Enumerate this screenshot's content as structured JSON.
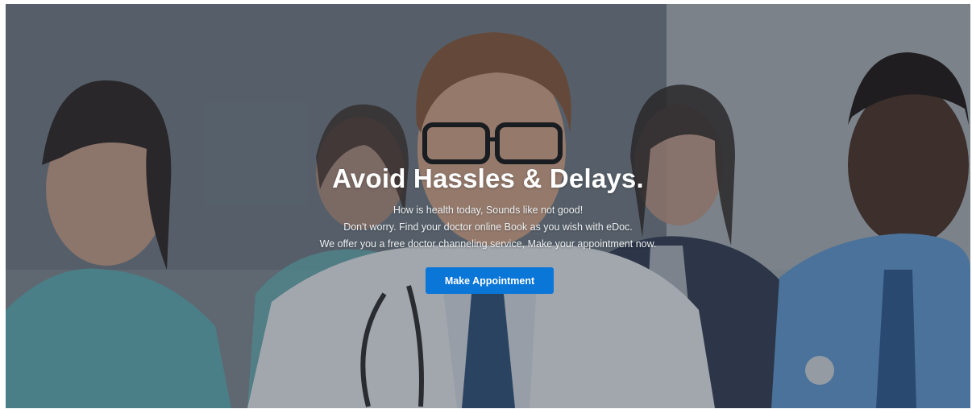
{
  "hero": {
    "headline": "Avoid Hassles & Delays.",
    "lines": [
      "How is health today, Sounds like not good!",
      "Don't worry. Find your doctor online Book as you wish with eDoc.",
      "We offer you a free doctor channeling service, Make your appointment now."
    ],
    "cta_label": "Make Appointment",
    "colors": {
      "accent": "#0a76d8",
      "text": "#ffffff"
    }
  }
}
